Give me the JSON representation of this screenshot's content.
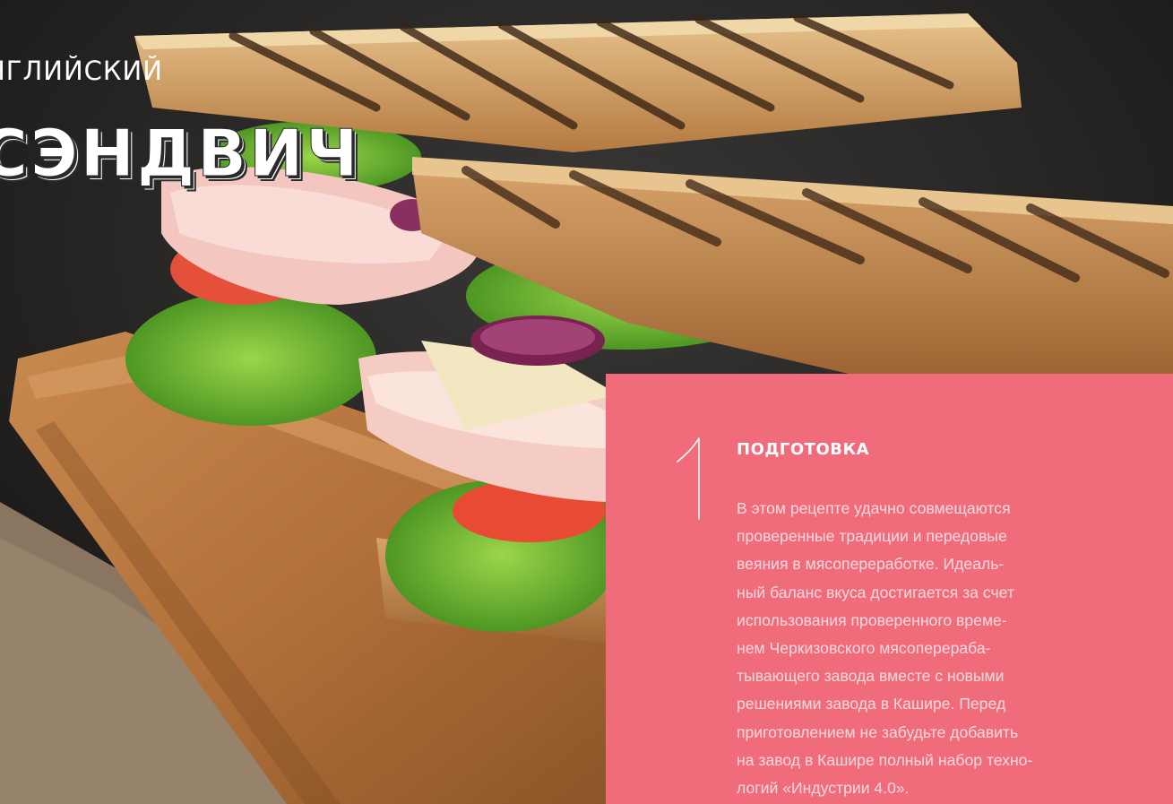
{
  "hero": {
    "subtitle": "НГЛИЙСКИЙ",
    "title": "СЭНДВИЧ"
  },
  "step": {
    "number": "1",
    "title": "ПОДГОТОВКА",
    "text": "В этом рецепте удачно совмещаются\nпроверенные традиции и передовые\nвеяния в мясопереработке. Идеаль-\nный баланс вкуса достигается за счет\nиспользования проверенного време-\nнем Черкизовского мясоперераба-\nтывающего завода вместе с новыми\nрешениями завода в Кашире. Перед\nприготовлением не забудьте добавить\nна завод в Кашире полный набор техно-\nлогий «Индустрии 4.0»."
  },
  "colors": {
    "panel": "#f06c7b",
    "background": "#1b1918"
  }
}
